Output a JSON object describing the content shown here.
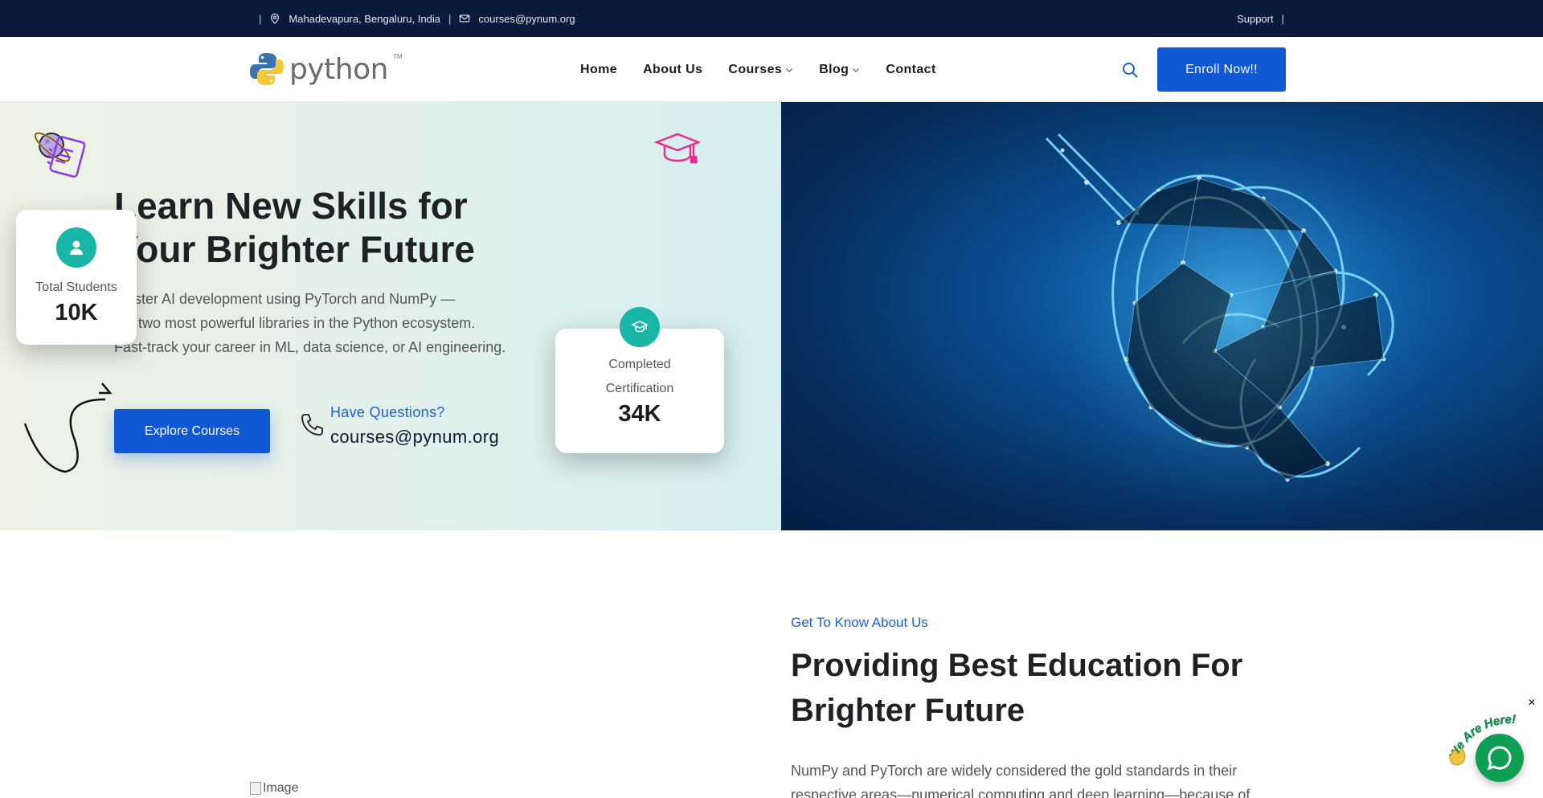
{
  "topbar": {
    "location": "Mahadevapura, Bengaluru, India",
    "email": "courses@pynum.org",
    "support": "Support",
    "separator": "|"
  },
  "header": {
    "logo_text": "python",
    "logo_tm": "TM",
    "nav": {
      "home": "Home",
      "about": "About Us",
      "courses": "Courses",
      "blog": "Blog",
      "contact": "Contact"
    },
    "enroll_label": "Enroll Now!!"
  },
  "hero": {
    "title_line1": "Learn New Skills for",
    "title_line2": "Your Brighter Future",
    "desc_line1": "Master AI development using PyTorch and NumPy —",
    "desc_line2": "the two most powerful libraries in the Python ecosystem.",
    "desc_line3": "Fast-track your career in ML, data science, or AI engineering.",
    "explore_label": "Explore Courses",
    "question_label": "Have Questions?",
    "contact_email": "courses@pynum.org"
  },
  "stats": {
    "students_label": "Total Students",
    "students_value": "10K",
    "cert_label": "Completed Certification",
    "cert_value": "34K"
  },
  "about": {
    "eyebrow": "Get To Know About Us",
    "title_line1": "Providing Best Education For",
    "title_line2": "Brighter Future",
    "text": "NumPy and PyTorch are widely considered the gold standards in their respective areas—numerical computing and deep learning—because of",
    "image_alt": "Image"
  },
  "chat": {
    "tagline": "We Are Here!",
    "close": "×"
  },
  "colors": {
    "topbar_bg": "#0b1a3a",
    "accent_blue": "#1158d6",
    "teal_badge": "#19b5a6",
    "chat_green": "#0e9f55"
  }
}
